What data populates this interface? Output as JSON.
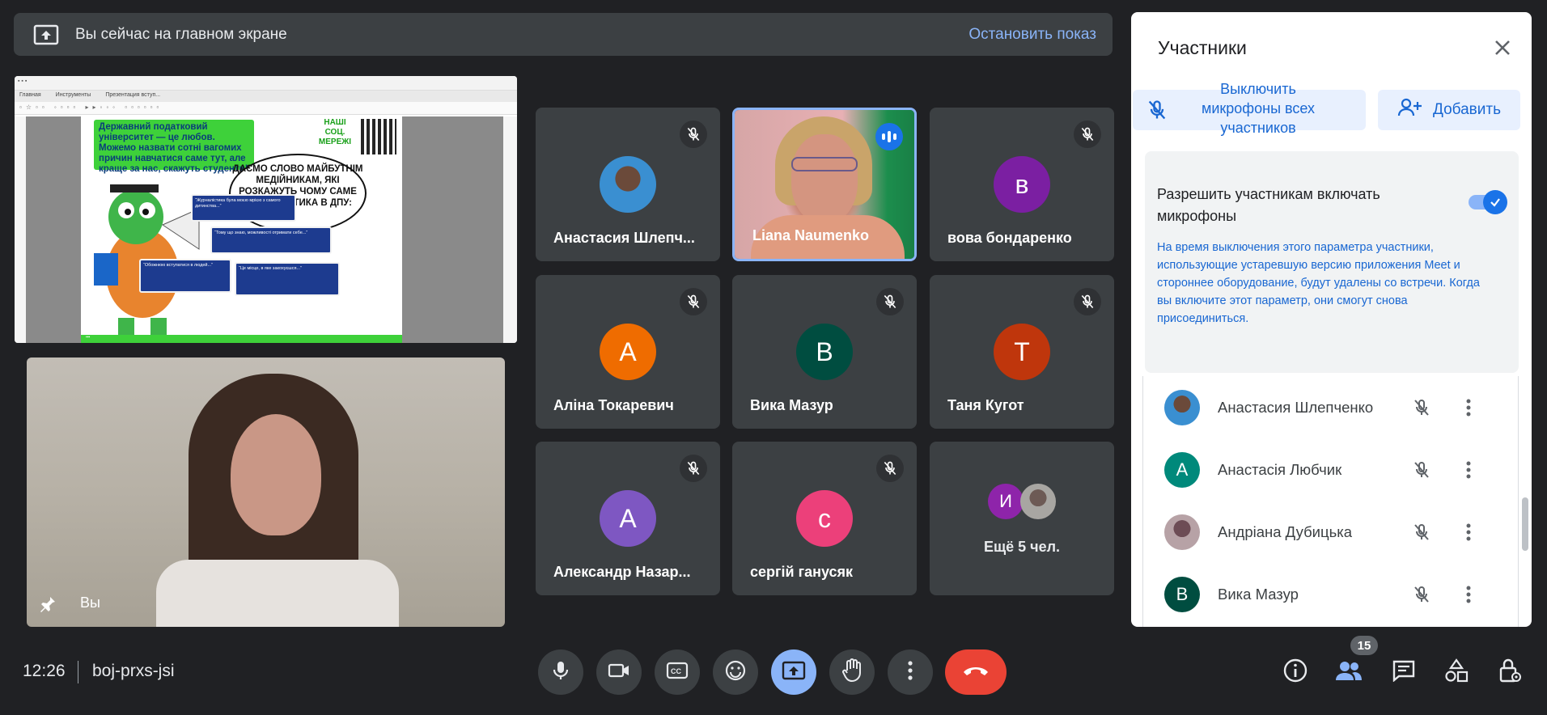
{
  "banner": {
    "icon": "present-to-all-icon",
    "text": "Вы сейчас на главном экране",
    "stop_label": "Остановить показ"
  },
  "presentation": {
    "pdf_tabs": [
      "Главная",
      "Инструменты",
      "Презентация вступ..."
    ],
    "green_text": "Державний податковий університет — це любов. Можемо назвати сотні вагомих причин навчатися саме тут, але краще за нас, скажуть студенти!",
    "social_text": "НАШІ СОЦ. МЕРЕЖІ",
    "bubble_text": "ДАЄМО СЛОВО МАЙБУТНІМ МЕДІЙНИКАМ, ЯКІ РОЗКАЖУТЬ ЧОМУ САМЕ ЖУРНАЛІСТИКА В ДПУ:"
  },
  "self_view": {
    "name": "Вы",
    "pin_icon": "pin-icon"
  },
  "tiles": [
    {
      "name": "Анастасия Шлепч...",
      "avatar": "photo",
      "muted": true
    },
    {
      "name": "Liana Naumenko",
      "avatar": "video",
      "speaking": true
    },
    {
      "name": "вова бондаренко",
      "avatar_letter": "в",
      "color": "#7b1fa2",
      "muted": true
    },
    {
      "name": "Аліна Токаревич",
      "avatar_letter": "А",
      "color": "#ef6c00",
      "muted": true
    },
    {
      "name": "Вика Мазур",
      "avatar_letter": "В",
      "color": "#004d40",
      "muted": true
    },
    {
      "name": "Таня Кугот",
      "avatar_letter": "Т",
      "color": "#bf360c",
      "muted": true
    },
    {
      "name": "Александр Назар...",
      "avatar_letter": "А",
      "color": "#7e57c2",
      "muted": true
    },
    {
      "name": "сергій ганусяк",
      "avatar_letter": "с",
      "color": "#ec407a",
      "muted": true
    }
  ],
  "more_tile": {
    "avatar_letter": "И",
    "avatar_color": "#8e24aa",
    "label": "Ещё 5 чел."
  },
  "panel": {
    "title": "Участники",
    "mute_all_label": "Выключить микрофоны всех участников",
    "add_label": "Добавить",
    "setting_title": "Разрешить участникам включать микрофоны",
    "setting_desc": "На время выключения этого параметра участники, использующие устаревшую версию приложения Meet и стороннее оборудование, будут удалены со встречи. Когда вы включите этот параметр, они смогут снова присоединиться.",
    "toggle_on": true,
    "participants": [
      {
        "name": "Анастасия Шлепченко",
        "avatar": "photo",
        "color": "#3a8fd1"
      },
      {
        "name": "Анастасія Любчик",
        "avatar_letter": "А",
        "color": "#00897b"
      },
      {
        "name": "Андріана Дубицька",
        "avatar": "photo",
        "color": "#9e7f86"
      },
      {
        "name": "Вика Мазур",
        "avatar_letter": "В",
        "color": "#004d40"
      }
    ]
  },
  "bottom_bar": {
    "time": "12:26",
    "meeting_code": "boj-prxs-jsi",
    "people_count": "15",
    "controls": [
      "mic-icon",
      "camera-icon",
      "captions-icon",
      "emoji-icon",
      "present-icon",
      "raise-hand-icon",
      "more-options-icon",
      "end-call-icon"
    ],
    "right_controls": [
      "info-icon",
      "people-icon",
      "chat-icon",
      "activities-icon",
      "host-controls-icon"
    ]
  },
  "colors": {
    "background": "#202124",
    "tile": "#3c4043",
    "accent_blue": "#8ab4f8",
    "end_call_red": "#ea4335"
  }
}
